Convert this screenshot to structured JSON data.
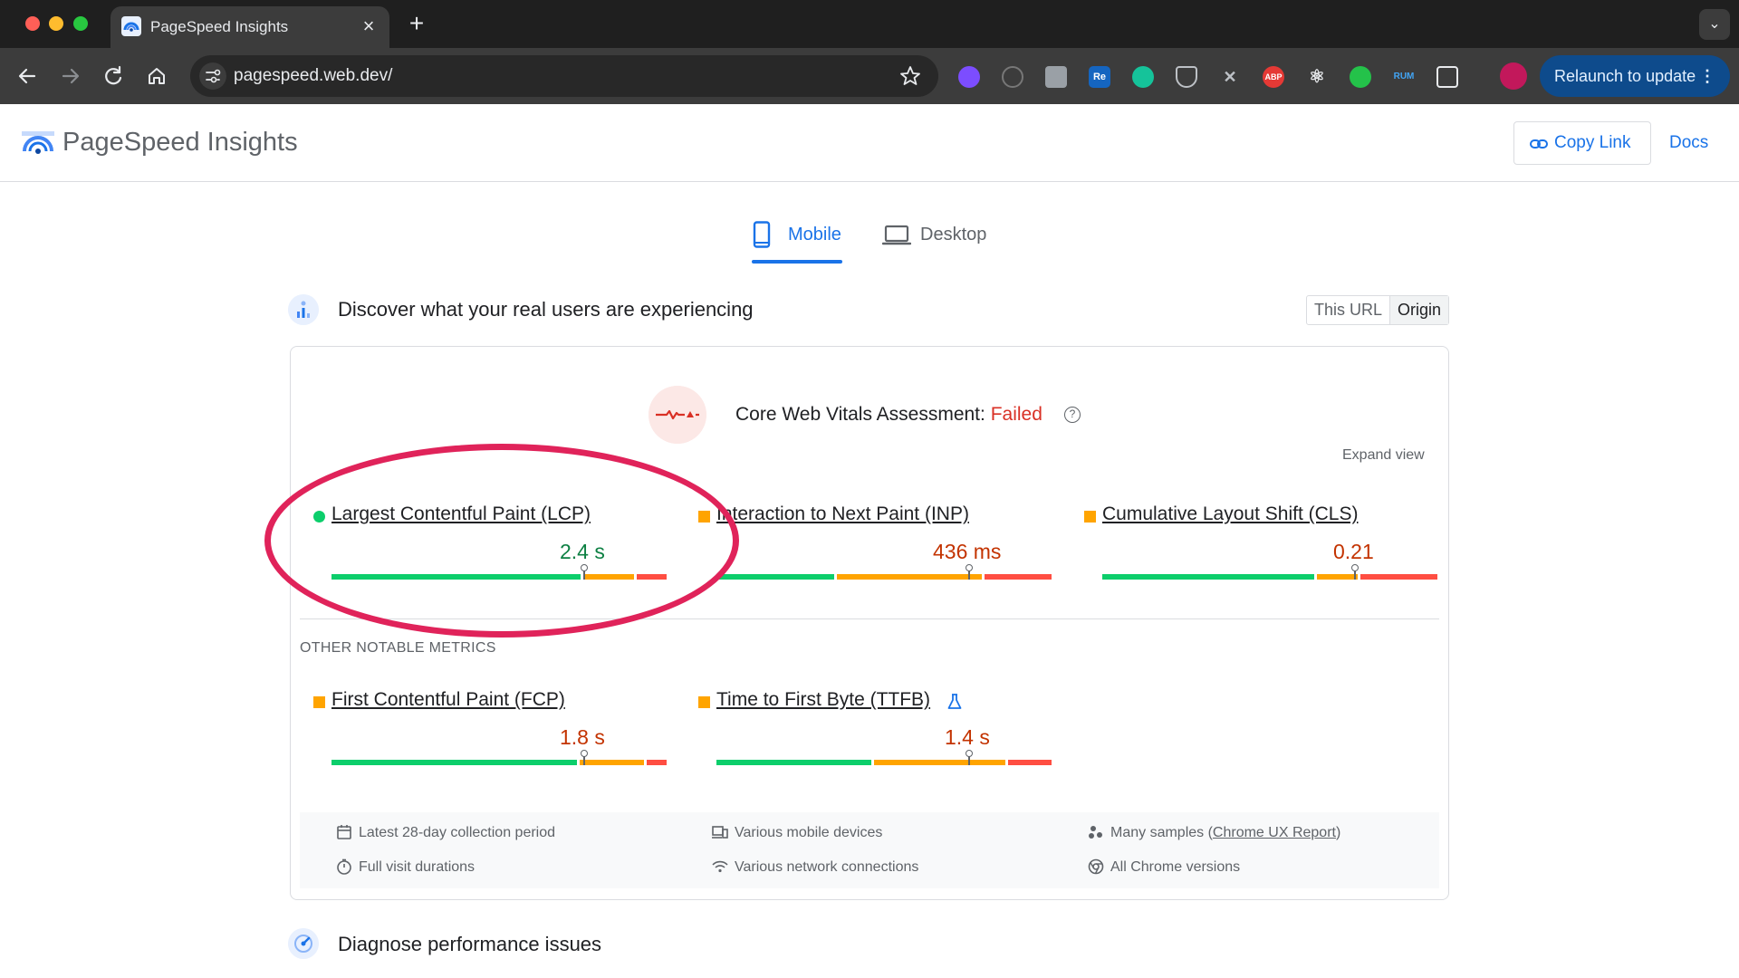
{
  "browser": {
    "tab_title": "PageSpeed Insights",
    "tab_close": "×",
    "new_tab": "+",
    "url": "pagespeed.web.dev/",
    "relaunch_label": "Relaunch to update",
    "extensions": [
      "Re",
      "ABP",
      "RUM"
    ]
  },
  "header": {
    "brand": "PageSpeed Insights",
    "copy_link": "Copy Link",
    "docs": "Docs"
  },
  "device_tabs": [
    {
      "label": "Mobile",
      "selected": true
    },
    {
      "label": "Desktop",
      "selected": false
    }
  ],
  "field_section": {
    "title": "Discover what your real users are experiencing",
    "toggle": [
      "This URL",
      "Origin"
    ],
    "toggle_selected": "Origin",
    "assessment_label": "Core Web Vitals Assessment:",
    "assessment_status": "Failed",
    "help_glyph": "?",
    "expand_view": "Expand view",
    "core_metrics": [
      {
        "name": "Largest Contentful Paint (LCP)",
        "value": "2.4 s",
        "rating": "good",
        "distribution": [
          0.75,
          0.16,
          0.09
        ],
        "marker_pct": 0.75
      },
      {
        "name": "Interaction to Next Paint (INP)",
        "value": "436 ms",
        "rating": "needs-improvement",
        "distribution": [
          0.36,
          0.44,
          0.2
        ],
        "marker_pct": 0.75
      },
      {
        "name": "Cumulative Layout Shift (CLS)",
        "value": "0.21",
        "rating": "needs-improvement",
        "distribution": [
          0.64,
          0.13,
          0.23
        ],
        "marker_pct": 0.75
      }
    ],
    "other_label": "OTHER NOTABLE METRICS",
    "other_metrics": [
      {
        "name": "First Contentful Paint (FCP)",
        "value": "1.8 s",
        "rating": "needs-improvement",
        "distribution": [
          0.74,
          0.2,
          0.06
        ],
        "marker_pct": 0.75
      },
      {
        "name": "Time to First Byte (TTFB)",
        "value": "1.4 s",
        "rating": "needs-improvement",
        "distribution": [
          0.47,
          0.4,
          0.13
        ],
        "marker_pct": 0.75,
        "experimental": true
      }
    ],
    "footer": {
      "collection_period": "Latest 28-day collection period",
      "visit_durations": "Full visit durations",
      "devices": "Various mobile devices",
      "network": "Various network connections",
      "samples_prefix": "Many samples (",
      "samples_link": "Chrome UX Report",
      "samples_suffix": ")",
      "chrome_versions": "All Chrome versions"
    }
  },
  "diagnose_section": {
    "title": "Diagnose performance issues"
  },
  "colors": {
    "good": "#0cce6b",
    "needs_improvement": "#ffa400",
    "poor": "#ff4e42",
    "failed": "#d93025",
    "accent": "#1a73e8",
    "annotation": "#e0235a"
  }
}
